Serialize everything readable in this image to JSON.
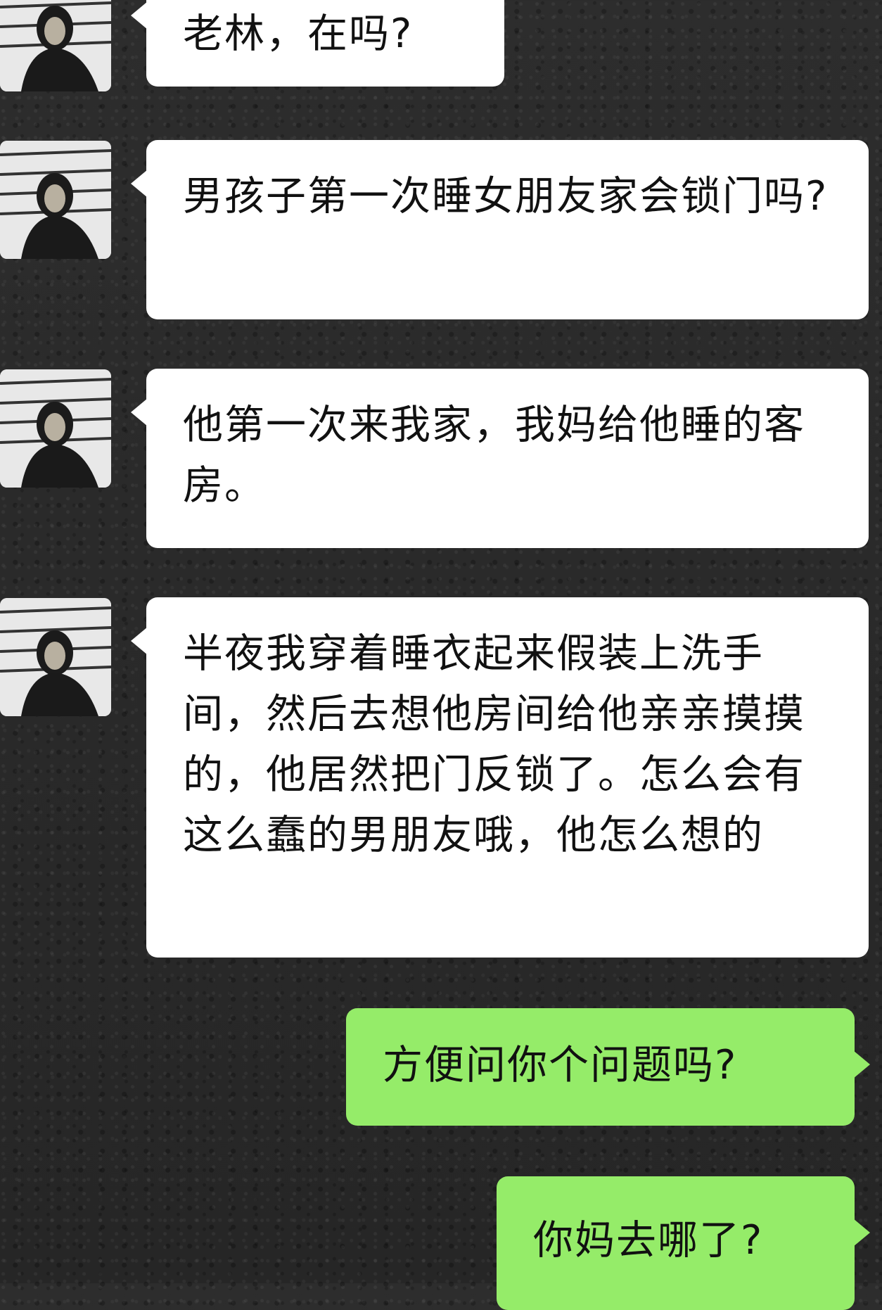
{
  "conversation": {
    "messages": [
      {
        "sender": "contact",
        "text": "老林，在吗?"
      },
      {
        "sender": "contact",
        "text": "男孩子第一次睡女朋友家会锁门吗?"
      },
      {
        "sender": "contact",
        "text": "他第一次来我家，我妈给他睡的客房。"
      },
      {
        "sender": "contact",
        "text": "半夜我穿着睡衣起来假装上洗手间，然后去想他房间给他亲亲摸摸的，他居然把门反锁了。怎么会有这么蠢的男朋友哦，他怎么想的"
      },
      {
        "sender": "me",
        "text": "方便问你个问题吗?"
      },
      {
        "sender": "me",
        "text": "你妈去哪了?"
      }
    ]
  },
  "colors": {
    "incoming_bubble": "#ffffff",
    "outgoing_bubble": "#95ec69",
    "background": "#2a2a2a"
  }
}
